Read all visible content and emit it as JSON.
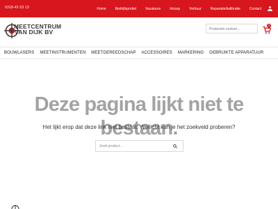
{
  "topbar": {
    "phone": "0318-45 03 13",
    "nav": [
      "Home",
      "Bedrijfsprofiel",
      "Vacatures",
      "Inkoop",
      "Verhuur",
      "Reparatie/kalibratie",
      "Contact"
    ]
  },
  "header": {
    "logo_line1": "MEETCENTRUM",
    "logo_line2": "VAN DIJK BV",
    "search_placeholder": "Producten zoeken...",
    "cart_count": "0"
  },
  "categories": [
    "BOUWLASERS",
    "MEETINSTRUMENTEN",
    "MEETGEREEDSCHAP",
    "ACCESSOIRES",
    "MARKERING",
    "GEBRUIKTE APPARATUUR"
  ],
  "main": {
    "title": "Deze pagina lijkt niet te bestaan.",
    "text": "Het lijkt erop dat deze link niet bestaat. Wellicht kun je het zoekveld proberen?",
    "search_placeholder": "Zoek product..."
  },
  "colors": {
    "brand_red": "#d8161d",
    "title_grey": "#a3a3a3"
  },
  "icons": {
    "user": "user-icon",
    "cart": "cart-icon",
    "search": "search-icon",
    "logo": "crosshair-logo"
  }
}
